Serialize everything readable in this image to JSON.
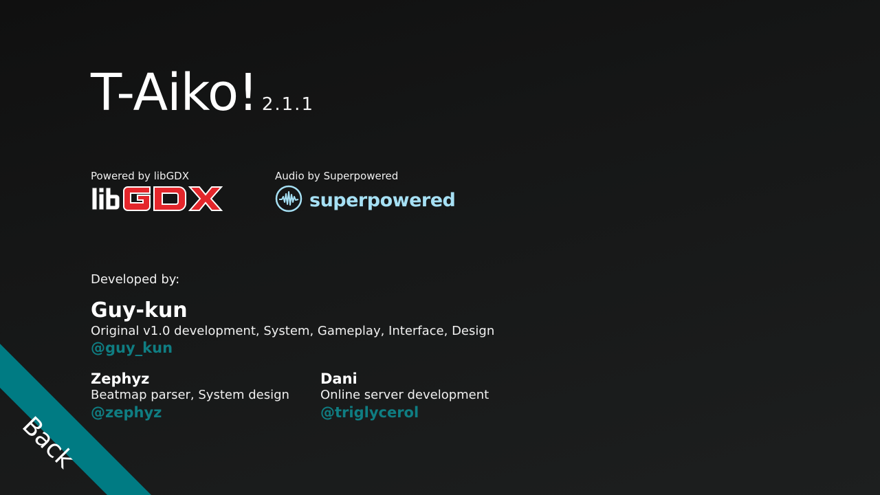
{
  "title": {
    "name": "T-Aiko!",
    "version": "2.1.1"
  },
  "powered": {
    "label": "Powered by libGDX",
    "logo_text_lib": "lib",
    "logo_text_gdx": "GDX",
    "logo_colors": {
      "lib": "#ffffff",
      "gdx": "#e4262b",
      "outline": "#ffffff"
    }
  },
  "audio": {
    "label": "Audio by Superpowered",
    "logo_text": "superpowered",
    "logo_icon": "waveform-circle-icon",
    "logo_color": "#a6e0f4"
  },
  "developers": {
    "label": "Developed by:",
    "lead": {
      "name": "Guy-kun",
      "role": "Original v1.0 development, System, Gameplay, Interface, Design",
      "handle": "@guy_kun"
    },
    "others": [
      {
        "name": "Zephyz",
        "role": "Beatmap parser, System design",
        "handle": "@zephyz"
      },
      {
        "name": "Dani",
        "role": "Online server development",
        "handle": "@triglycerol"
      }
    ]
  },
  "back_button": {
    "label": "Back",
    "color": "#007b83"
  },
  "colors": {
    "handle": "#0f7d82",
    "background": "#151616"
  }
}
